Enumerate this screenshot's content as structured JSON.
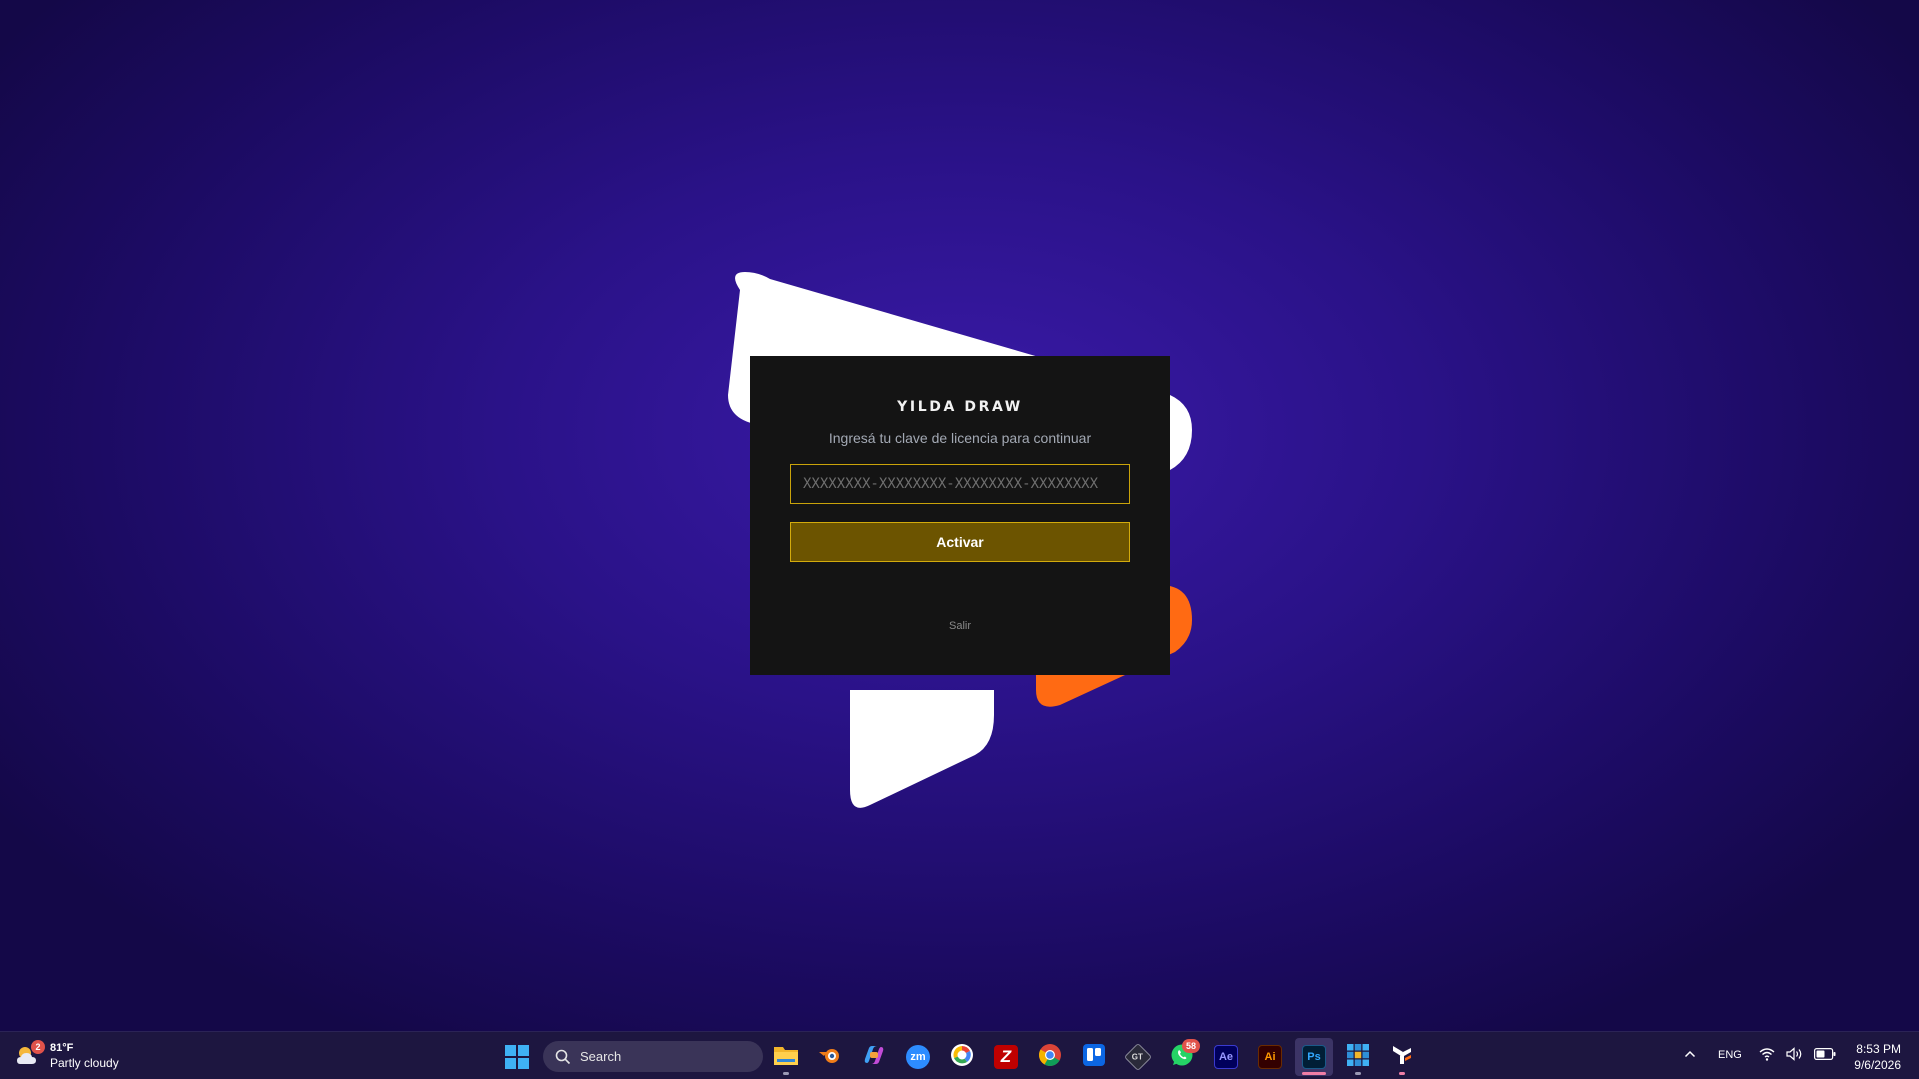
{
  "dialog": {
    "title": "YILDA DRAW",
    "subtitle": "Ingresá tu clave de licencia para continuar",
    "license_placeholder": "XXXXXXXX-XXXXXXXX-XXXXXXXX-XXXXXXXX",
    "activate_label": "Activar",
    "exit_label": "Salir"
  },
  "colors": {
    "accent_gold": "#d3ab0c",
    "button_fill": "#6c5400",
    "dialog_bg": "#141414",
    "logo_orange": "#ff6a13"
  },
  "taskbar": {
    "weather": {
      "temp": "81°F",
      "desc": "Partly cloudy",
      "badge": "2"
    },
    "search_label": "Search",
    "apps": [
      {
        "name": "file-explorer-icon"
      },
      {
        "name": "blender-icon"
      },
      {
        "name": "copilot-icon"
      },
      {
        "name": "zoom-icon",
        "label": "zm"
      },
      {
        "name": "google-app-icon"
      },
      {
        "name": "filezilla-icon",
        "label": "Z"
      },
      {
        "name": "chrome-icon"
      },
      {
        "name": "trello-icon"
      },
      {
        "name": "gt-app-icon",
        "label": "GT"
      },
      {
        "name": "whatsapp-icon",
        "badge": "58"
      },
      {
        "name": "after-effects-icon",
        "label": "Ae"
      },
      {
        "name": "illustrator-icon",
        "label": "Ai"
      },
      {
        "name": "photoshop-icon",
        "label": "Ps"
      },
      {
        "name": "grid-app-icon"
      },
      {
        "name": "yilda-draw-icon"
      }
    ],
    "language": "ENG",
    "time": "8:53 PM",
    "date": "9/6/2026"
  }
}
